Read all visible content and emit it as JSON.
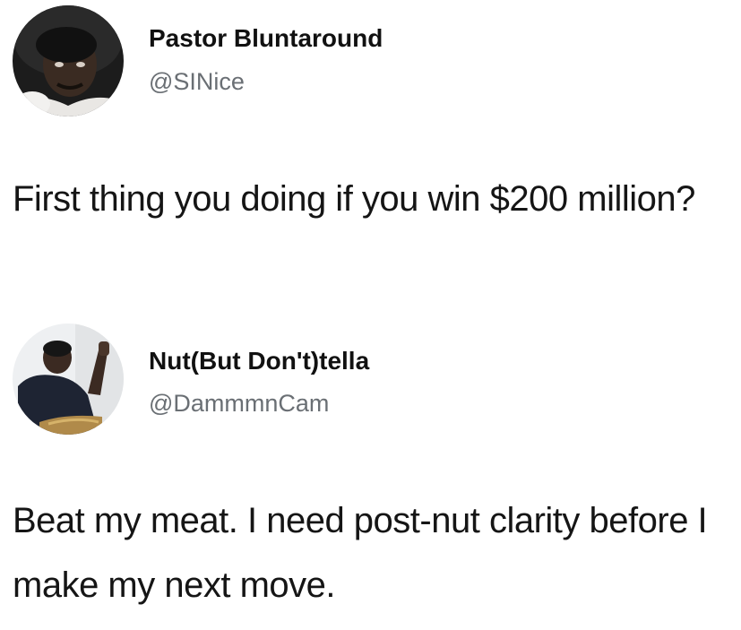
{
  "tweets": [
    {
      "display_name": "Pastor Bluntaround",
      "handle": "@SINice",
      "text": "First thing you doing if you win $200 million?",
      "avatar_icon": "profile-photo"
    },
    {
      "display_name": "Nut(But Don't)tella",
      "handle": "@DammmnCam",
      "text": "Beat my meat. I need post-nut clarity before I make my next move.",
      "avatar_icon": "profile-photo"
    }
  ],
  "colors": {
    "name": "#111111",
    "handle": "#6a6f74",
    "text": "#151515",
    "background": "#ffffff"
  }
}
